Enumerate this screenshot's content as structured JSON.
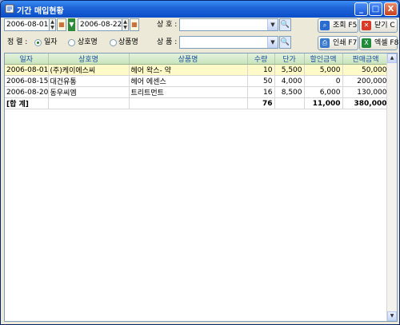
{
  "window": {
    "title": "기간 매입현황",
    "min_glyph": "_",
    "max_glyph": "□",
    "close_glyph": "X"
  },
  "filters": {
    "date_from": "2006-08-01",
    "date_to": "2006-08-22",
    "shop_label": "상 호 :",
    "shop_value": "",
    "product_label": "상 품 :",
    "product_value": "",
    "sort_label": "정 렬 :",
    "sort_options": [
      "일자",
      "상호명",
      "상품명"
    ],
    "sort_selected": 0
  },
  "buttons": {
    "query": "조회 F5",
    "close": "닫기 C",
    "print": "인쇄 F7",
    "excel": "엑셀 F8"
  },
  "table": {
    "columns": [
      "일자",
      "상호명",
      "상품명",
      "수량",
      "단가",
      "할인금액",
      "판매금액"
    ],
    "rows": [
      [
        "2006-08-01",
        "(주)케이에스씨",
        "헤어 왁스- 약",
        "10",
        "5,500",
        "5,000",
        "50,000"
      ],
      [
        "2006-08-15",
        "대건유통",
        "헤어 에센스",
        "50",
        "4,000",
        "0",
        "200,000"
      ],
      [
        "2006-08-20",
        "동우씨엠",
        "트리트먼트",
        "16",
        "8,500",
        "6,000",
        "130,000"
      ]
    ],
    "total": [
      "[합 계]",
      "",
      "",
      "76",
      "",
      "11,000",
      "380,000"
    ]
  },
  "colors": {
    "titlebar": "#1f65d8",
    "highlight_row": "#fffac8",
    "header_bg": "#c9e4bc",
    "header_text": "#1a4fa0"
  }
}
